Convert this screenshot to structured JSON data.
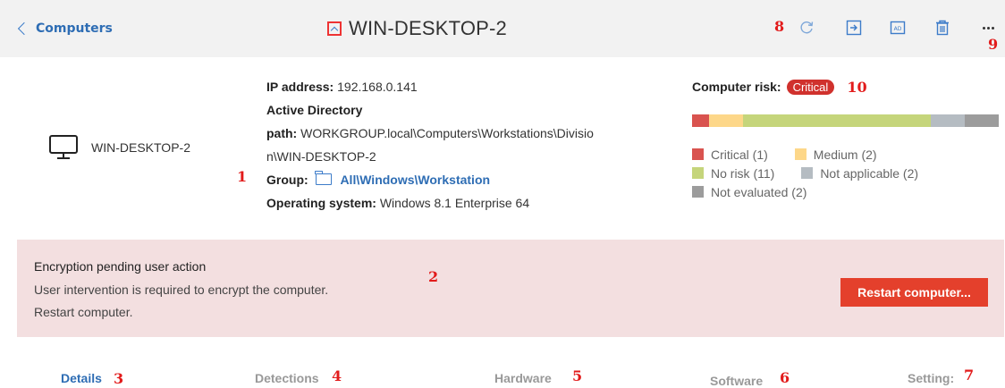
{
  "header": {
    "back_label": "Computers",
    "title": "WIN-DESKTOP-2"
  },
  "computer": {
    "name": "WIN-DESKTOP-2"
  },
  "details": {
    "ip_label": "IP address:",
    "ip_value": "192.168.0.141",
    "ad_label": "Active Directory",
    "path_label": "path:",
    "path_value_line1": "WORKGROUP.local\\Computers\\Workstations\\Divisio",
    "path_value_line2": "n\\WIN-DESKTOP-2",
    "group_label": "Group:",
    "group_value": "All\\Windows\\Workstation",
    "os_label": "Operating system:",
    "os_value": "Windows 8.1 Enterprise 64"
  },
  "risk": {
    "label": "Computer risk:",
    "badge": "Critical",
    "bar": [
      {
        "name": "Critical",
        "count": 1,
        "color": "#d9534f"
      },
      {
        "name": "Medium",
        "count": 2,
        "color": "#fdd789"
      },
      {
        "name": "No risk",
        "count": 11,
        "color": "#c5d57b"
      },
      {
        "name": "Not applicable",
        "count": 2,
        "color": "#b5bcc2"
      },
      {
        "name": "Not evaluated",
        "count": 2,
        "color": "#9c9c9c"
      }
    ],
    "legend": {
      "critical": "Critical (1)",
      "medium": "Medium (2)",
      "no_risk": "No risk (11)",
      "not_applicable": "Not applicable (2)",
      "not_evaluated": "Not evaluated (2)"
    }
  },
  "alert": {
    "title": "Encryption pending user action",
    "line1": "User intervention is required to encrypt the computer.",
    "line2": "Restart computer.",
    "button": "Restart computer..."
  },
  "tabs": [
    {
      "label": "Details"
    },
    {
      "label": "Detections"
    },
    {
      "label": "Hardware"
    },
    {
      "label": "Software"
    },
    {
      "label": "Setting:"
    }
  ],
  "annotations": {
    "a1": "1",
    "a2": "2",
    "a3": "3",
    "a4": "4",
    "a5": "5",
    "a6": "6",
    "a7": "7",
    "a8": "8",
    "a9": "9",
    "a10": "10"
  },
  "colors": {
    "accent": "#2e6db4",
    "danger": "#e4402c",
    "alert_bg": "#f3dfe0",
    "annotation": "#e21b1b"
  }
}
